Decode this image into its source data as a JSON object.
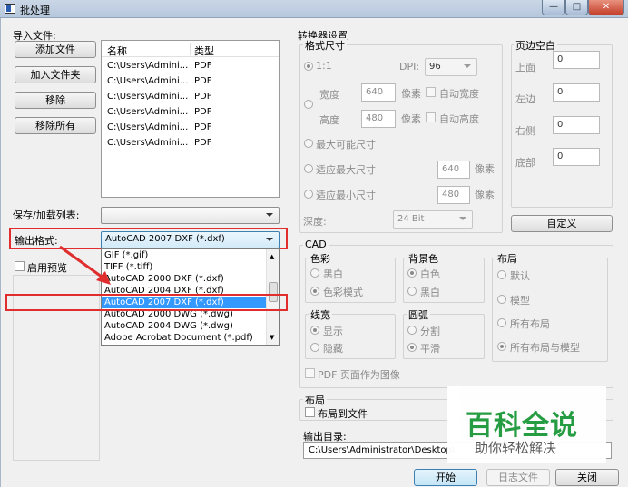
{
  "window": {
    "title": "批处理"
  },
  "left": {
    "import_label": "导入文件:",
    "buttons": {
      "add_file": "添加文件",
      "add_folder": "加入文件夹",
      "remove": "移除",
      "remove_all": "移除所有"
    },
    "file_list": {
      "headers": [
        "名称",
        "类型"
      ],
      "rows": [
        [
          "C:\\Users\\Admini...",
          "PDF"
        ],
        [
          "C:\\Users\\Admini...",
          "PDF"
        ],
        [
          "C:\\Users\\Admini...",
          "PDF"
        ],
        [
          "C:\\Users\\Admini...",
          "PDF"
        ],
        [
          "C:\\Users\\Admini...",
          "PDF"
        ],
        [
          "C:\\Users\\Admini...",
          "PDF"
        ]
      ]
    },
    "save_load_label": "保存/加载列表:",
    "output_format_label": "输出格式:",
    "output_format_value": "AutoCAD 2007 DXF (*.dxf)",
    "preview_label": "启用预览",
    "format_options": [
      "GIF (*.gif)",
      "TIFF (*.tiff)",
      "AutoCAD 2000 DXF (*.dxf)",
      "AutoCAD 2004 DXF (*.dxf)",
      "AutoCAD 2007 DXF (*.dxf)",
      "AutoCAD 2000 DWG (*.dwg)",
      "AutoCAD 2004 DWG (*.dwg)",
      "Adobe Acrobat Document (*.pdf)"
    ]
  },
  "converter": {
    "title": "转换器设置",
    "format_size": {
      "title": "格式尺寸",
      "ratio": "1:1",
      "dpi_label": "DPI:",
      "dpi_value": "96",
      "width_label": "宽度",
      "width_value": "640",
      "height_label": "高度",
      "height_value": "480",
      "unit": "像素",
      "auto_width": "自动宽度",
      "auto_height": "自动高度",
      "max_possible": "最大可能尺寸",
      "fit_max": "适应最大尺寸",
      "fit_max_value": "640",
      "fit_min": "适应最小尺寸",
      "fit_min_value": "480",
      "depth_label": "深度:",
      "depth_value": "24 Bit"
    },
    "margins": {
      "title": "页边空白",
      "top_label": "上面",
      "top": "0",
      "left_label": "左边",
      "left": "0",
      "right_label": "右侧",
      "right": "0",
      "bottom_label": "底部",
      "bottom": "0",
      "custom_button": "自定义"
    },
    "cad": {
      "title": "CAD",
      "color": {
        "title": "色彩",
        "bw": "黑白",
        "color_mode": "色彩模式"
      },
      "background": {
        "title": "背景色",
        "white": "白色",
        "black": "黑白"
      },
      "layout": {
        "title": "布局",
        "default": "默认",
        "model": "模型",
        "all_layouts": "所有布局",
        "all_layouts_model": "所有布局与模型"
      },
      "lineweight": {
        "title": "线宽",
        "show": "显示",
        "hide": "隐藏"
      },
      "arc": {
        "title": "圆弧",
        "split": "分割",
        "smooth": "平滑"
      },
      "pdf_as_image": "PDF 页面作为图像"
    },
    "layout_section": {
      "title": "布局",
      "layout_to_file": "布局到文件"
    },
    "output_dir": {
      "label": "输出目录:",
      "value": "C:\\Users\\Administrator\\Desktop\\"
    }
  },
  "footer": {
    "start": "开始",
    "log": "日志文件",
    "close": "关闭"
  },
  "watermark": {
    "title": "百科全说",
    "subtitle": "助你轻松解决"
  },
  "colors": {
    "highlight": "#e02d2d",
    "selection": "#3399ff",
    "watermark_green": "#1e9a3c"
  }
}
